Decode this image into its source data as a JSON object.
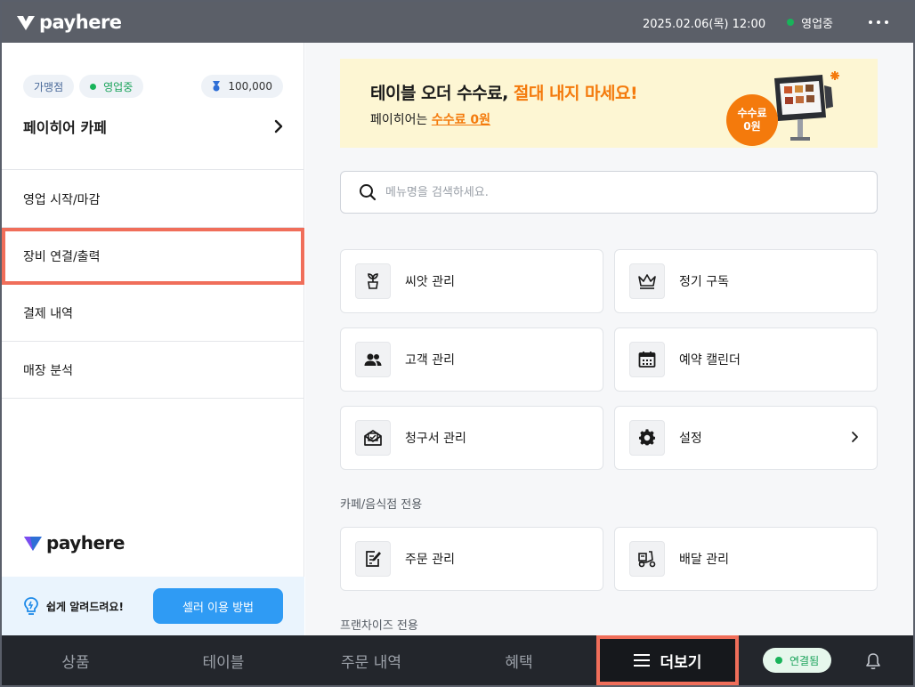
{
  "header": {
    "logo_text": "payhere",
    "datetime": "2025.02.06(목) 12:00",
    "status": "영업중"
  },
  "sidebar": {
    "badges": {
      "type": "가맹점",
      "status": "영업중",
      "points": "100,000"
    },
    "store_name": "페이히어 카페",
    "items": [
      {
        "label": "영업 시작/마감"
      },
      {
        "label": "장비 연결/출력"
      },
      {
        "label": "결제 내역"
      },
      {
        "label": "매장 분석"
      }
    ],
    "logo_text": "payhere",
    "help_text": "쉽게 알려드려요!",
    "help_button": "셀러 이용 방법"
  },
  "banner": {
    "title_prefix": "테이블 오더 수수료, ",
    "title_accent": "절대 내지 마세요!",
    "sub_prefix": "페이히어는 ",
    "sub_accent": "수수료 0원",
    "fee_line1": "수수료",
    "fee_line2": "0원"
  },
  "search": {
    "placeholder": "메뉴명을 검색하세요."
  },
  "cards": {
    "seed": "씨앗 관리",
    "subscription": "정기 구독",
    "customer": "고객 관리",
    "reservation": "예약 캘린더",
    "invoice": "청구서 관리",
    "settings": "설정",
    "order": "주문 관리",
    "delivery": "배달 관리"
  },
  "sections": {
    "cafe": "카페/음식점 전용",
    "franchise": "프랜차이즈 전용"
  },
  "bottom": {
    "tabs": [
      "상품",
      "테이블",
      "주문 내역",
      "혜택"
    ],
    "more": "더보기",
    "connected": "연결됨"
  },
  "colors": {
    "accent": "#f47a0c",
    "brand_blue": "#2f9bf4",
    "status_green": "#19b35a",
    "highlight": "#f06e5a"
  }
}
